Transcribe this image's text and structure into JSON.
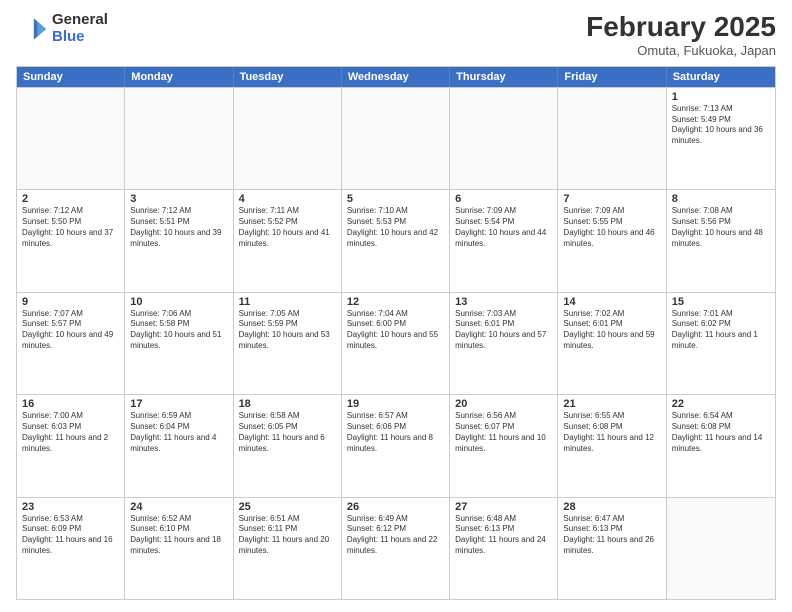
{
  "logo": {
    "general": "General",
    "blue": "Blue"
  },
  "title": "February 2025",
  "location": "Omuta, Fukuoka, Japan",
  "weekdays": [
    "Sunday",
    "Monday",
    "Tuesday",
    "Wednesday",
    "Thursday",
    "Friday",
    "Saturday"
  ],
  "weeks": [
    [
      {
        "day": "",
        "info": ""
      },
      {
        "day": "",
        "info": ""
      },
      {
        "day": "",
        "info": ""
      },
      {
        "day": "",
        "info": ""
      },
      {
        "day": "",
        "info": ""
      },
      {
        "day": "",
        "info": ""
      },
      {
        "day": "1",
        "info": "Sunrise: 7:13 AM\nSunset: 5:49 PM\nDaylight: 10 hours and 36 minutes."
      }
    ],
    [
      {
        "day": "2",
        "info": "Sunrise: 7:12 AM\nSunset: 5:50 PM\nDaylight: 10 hours and 37 minutes."
      },
      {
        "day": "3",
        "info": "Sunrise: 7:12 AM\nSunset: 5:51 PM\nDaylight: 10 hours and 39 minutes."
      },
      {
        "day": "4",
        "info": "Sunrise: 7:11 AM\nSunset: 5:52 PM\nDaylight: 10 hours and 41 minutes."
      },
      {
        "day": "5",
        "info": "Sunrise: 7:10 AM\nSunset: 5:53 PM\nDaylight: 10 hours and 42 minutes."
      },
      {
        "day": "6",
        "info": "Sunrise: 7:09 AM\nSunset: 5:54 PM\nDaylight: 10 hours and 44 minutes."
      },
      {
        "day": "7",
        "info": "Sunrise: 7:09 AM\nSunset: 5:55 PM\nDaylight: 10 hours and 46 minutes."
      },
      {
        "day": "8",
        "info": "Sunrise: 7:08 AM\nSunset: 5:56 PM\nDaylight: 10 hours and 48 minutes."
      }
    ],
    [
      {
        "day": "9",
        "info": "Sunrise: 7:07 AM\nSunset: 5:57 PM\nDaylight: 10 hours and 49 minutes."
      },
      {
        "day": "10",
        "info": "Sunrise: 7:06 AM\nSunset: 5:58 PM\nDaylight: 10 hours and 51 minutes."
      },
      {
        "day": "11",
        "info": "Sunrise: 7:05 AM\nSunset: 5:59 PM\nDaylight: 10 hours and 53 minutes."
      },
      {
        "day": "12",
        "info": "Sunrise: 7:04 AM\nSunset: 6:00 PM\nDaylight: 10 hours and 55 minutes."
      },
      {
        "day": "13",
        "info": "Sunrise: 7:03 AM\nSunset: 6:01 PM\nDaylight: 10 hours and 57 minutes."
      },
      {
        "day": "14",
        "info": "Sunrise: 7:02 AM\nSunset: 6:01 PM\nDaylight: 10 hours and 59 minutes."
      },
      {
        "day": "15",
        "info": "Sunrise: 7:01 AM\nSunset: 6:02 PM\nDaylight: 11 hours and 1 minute."
      }
    ],
    [
      {
        "day": "16",
        "info": "Sunrise: 7:00 AM\nSunset: 6:03 PM\nDaylight: 11 hours and 2 minutes."
      },
      {
        "day": "17",
        "info": "Sunrise: 6:59 AM\nSunset: 6:04 PM\nDaylight: 11 hours and 4 minutes."
      },
      {
        "day": "18",
        "info": "Sunrise: 6:58 AM\nSunset: 6:05 PM\nDaylight: 11 hours and 6 minutes."
      },
      {
        "day": "19",
        "info": "Sunrise: 6:57 AM\nSunset: 6:06 PM\nDaylight: 11 hours and 8 minutes."
      },
      {
        "day": "20",
        "info": "Sunrise: 6:56 AM\nSunset: 6:07 PM\nDaylight: 11 hours and 10 minutes."
      },
      {
        "day": "21",
        "info": "Sunrise: 6:55 AM\nSunset: 6:08 PM\nDaylight: 11 hours and 12 minutes."
      },
      {
        "day": "22",
        "info": "Sunrise: 6:54 AM\nSunset: 6:08 PM\nDaylight: 11 hours and 14 minutes."
      }
    ],
    [
      {
        "day": "23",
        "info": "Sunrise: 6:53 AM\nSunset: 6:09 PM\nDaylight: 11 hours and 16 minutes."
      },
      {
        "day": "24",
        "info": "Sunrise: 6:52 AM\nSunset: 6:10 PM\nDaylight: 11 hours and 18 minutes."
      },
      {
        "day": "25",
        "info": "Sunrise: 6:51 AM\nSunset: 6:11 PM\nDaylight: 11 hours and 20 minutes."
      },
      {
        "day": "26",
        "info": "Sunrise: 6:49 AM\nSunset: 6:12 PM\nDaylight: 11 hours and 22 minutes."
      },
      {
        "day": "27",
        "info": "Sunrise: 6:48 AM\nSunset: 6:13 PM\nDaylight: 11 hours and 24 minutes."
      },
      {
        "day": "28",
        "info": "Sunrise: 6:47 AM\nSunset: 6:13 PM\nDaylight: 11 hours and 26 minutes."
      },
      {
        "day": "",
        "info": ""
      }
    ]
  ]
}
